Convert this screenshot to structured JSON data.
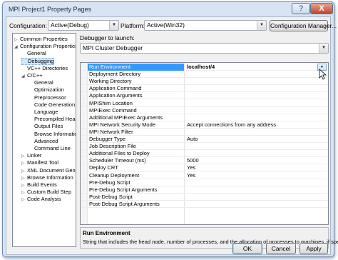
{
  "window": {
    "title": "MPI Project1 Property Pages",
    "help_glyph": "?",
    "close_glyph": "X"
  },
  "config_bar": {
    "configuration_label": "Configuration:",
    "configuration_value": "Active(Debug)",
    "platform_label": "Platform:",
    "platform_value": "Active(Win32)",
    "config_manager_label": "Configuration Manager..."
  },
  "launcher": {
    "label": "Debugger to launch:",
    "value": "MPI Cluster Debugger"
  },
  "tree": [
    {
      "label": "Common Properties",
      "exp": "▷"
    },
    {
      "label": "Configuration Properties",
      "exp": "◢"
    },
    {
      "label": "General",
      "exp": ""
    },
    {
      "label": "Debugging",
      "exp": ""
    },
    {
      "label": "VC++ Directories",
      "exp": ""
    },
    {
      "label": "C/C++",
      "exp": "◢"
    },
    {
      "label": "General",
      "exp": ""
    },
    {
      "label": "Optimization",
      "exp": ""
    },
    {
      "label": "Preprocessor",
      "exp": ""
    },
    {
      "label": "Code Generation",
      "exp": ""
    },
    {
      "label": "Language",
      "exp": ""
    },
    {
      "label": "Precompiled Headers",
      "exp": ""
    },
    {
      "label": "Output Files",
      "exp": ""
    },
    {
      "label": "Browse Information",
      "exp": ""
    },
    {
      "label": "Advanced",
      "exp": ""
    },
    {
      "label": "Command Line",
      "exp": ""
    },
    {
      "label": "Linker",
      "exp": "▷"
    },
    {
      "label": "Manifest Tool",
      "exp": "▷"
    },
    {
      "label": "XML Document Generator",
      "exp": "▷"
    },
    {
      "label": "Browse Information",
      "exp": "▷"
    },
    {
      "label": "Build Events",
      "exp": "▷"
    },
    {
      "label": "Custom Build Step",
      "exp": "▷"
    },
    {
      "label": "Code Analysis",
      "exp": "▷"
    }
  ],
  "properties": [
    {
      "name": "Run Environment",
      "value": "localhost/4"
    },
    {
      "name": "Deployment Directory",
      "value": ""
    },
    {
      "name": "Working Directory",
      "value": ""
    },
    {
      "name": "Application Command",
      "value": ""
    },
    {
      "name": "Application Arguments",
      "value": ""
    },
    {
      "name": "MPIShim Location",
      "value": ""
    },
    {
      "name": "MPIExec Command",
      "value": ""
    },
    {
      "name": "Additional MPIExec Arguments",
      "value": ""
    },
    {
      "name": "MPI Network Security Mode",
      "value": "Accept connections from any address"
    },
    {
      "name": "MPI Network Filter",
      "value": ""
    },
    {
      "name": "Debugger Type",
      "value": "Auto"
    },
    {
      "name": "Job Description File",
      "value": ""
    },
    {
      "name": "Additional Files to Deploy",
      "value": ""
    },
    {
      "name": "Scheduler Timeout (ms)",
      "value": "5000"
    },
    {
      "name": "Deploy CRT",
      "value": "Yes"
    },
    {
      "name": "Cleanup Deployment",
      "value": "Yes"
    },
    {
      "name": "Pre-Debug Script",
      "value": ""
    },
    {
      "name": "Pre-Debug Script Arguments",
      "value": ""
    },
    {
      "name": "Post-Debug Script",
      "value": ""
    },
    {
      "name": "Post-Debug Script Arguments",
      "value": ""
    }
  ],
  "description": {
    "title": "Run Environment",
    "body": "String that includes the head node, number of processes, and the allocation of processes to machines, if specified."
  },
  "buttons": {
    "ok": "OK",
    "cancel": "Cancel",
    "apply": "Apply"
  },
  "glyphs": {
    "dropdown": "▼"
  },
  "colors": {
    "selection": "#3399ff",
    "tree_selection": "#cde8ff"
  }
}
